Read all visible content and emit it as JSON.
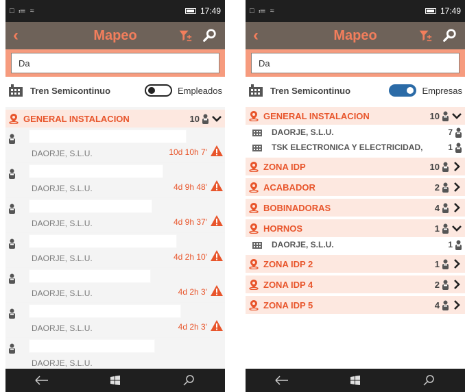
{
  "left": {
    "status": {
      "time": "17:49"
    },
    "header": {
      "title": "Mapeo"
    },
    "search": {
      "value": "Da"
    },
    "toolbar": {
      "label": "Tren Semicontinuo",
      "toggle_label": "Empleados",
      "toggle_state": "off"
    },
    "zone": {
      "name": "GENERAL INSTALACION",
      "count": "10"
    },
    "employees": [
      {
        "company": "DAORJE, S.L.U.",
        "time": "10d 10h 7'"
      },
      {
        "company": "DAORJE, S.L.U.",
        "time": "4d 9h 48'"
      },
      {
        "company": "DAORJE, S.L.U.",
        "time": "4d 9h 37'"
      },
      {
        "company": "DAORJE, S.L.U.",
        "time": "4d 2h 10'"
      },
      {
        "company": "DAORJE, S.L.U.",
        "time": "4d 2h 3'"
      },
      {
        "company": "DAORJE, S.L.U.",
        "time": "4d 2h 3'"
      },
      {
        "company": "DAORJE, S.L.U.",
        "time": ""
      }
    ]
  },
  "right": {
    "status": {
      "time": "17:49"
    },
    "header": {
      "title": "Mapeo"
    },
    "search": {
      "value": "Da"
    },
    "toolbar": {
      "label": "Tren Semicontinuo",
      "toggle_label": "Empresas",
      "toggle_state": "on"
    },
    "zones": [
      {
        "name": "GENERAL INSTALACION",
        "count": "10",
        "expanded": true,
        "companies": [
          {
            "name": "DAORJE, S.L.U.",
            "count": "7"
          },
          {
            "name": "TSK ELECTRONICA Y ELECTRICIDAD,",
            "count": "1"
          }
        ]
      },
      {
        "name": "ZONA IDP",
        "count": "10",
        "expanded": false,
        "companies": []
      },
      {
        "name": "ACABADOR",
        "count": "2",
        "expanded": false,
        "companies": []
      },
      {
        "name": "BOBINADORAS",
        "count": "4",
        "expanded": false,
        "companies": []
      },
      {
        "name": "HORNOS",
        "count": "1",
        "expanded": true,
        "companies": [
          {
            "name": "DAORJE, S.L.U.",
            "count": "1"
          }
        ]
      },
      {
        "name": "ZONA IDP 2",
        "count": "1",
        "expanded": false,
        "companies": []
      },
      {
        "name": "ZONA IDP 4",
        "count": "2",
        "expanded": false,
        "companies": []
      },
      {
        "name": "ZONA IDP 5",
        "count": "4",
        "expanded": false,
        "companies": []
      }
    ]
  },
  "colors": {
    "accent": "#e8552b",
    "header_bg": "#6e6259",
    "search_bg": "#f69b7e",
    "toggle_on": "#2b6ba7"
  },
  "icons": {
    "back": "back-arrow-icon",
    "filter": "filter-icon",
    "search": "search-icon",
    "factory": "factory-icon",
    "pin": "location-pin-icon",
    "person": "person-icon",
    "warning": "warning-icon",
    "nav_back": "nav-back-icon",
    "nav_home": "windows-icon",
    "nav_search": "nav-search-icon"
  }
}
